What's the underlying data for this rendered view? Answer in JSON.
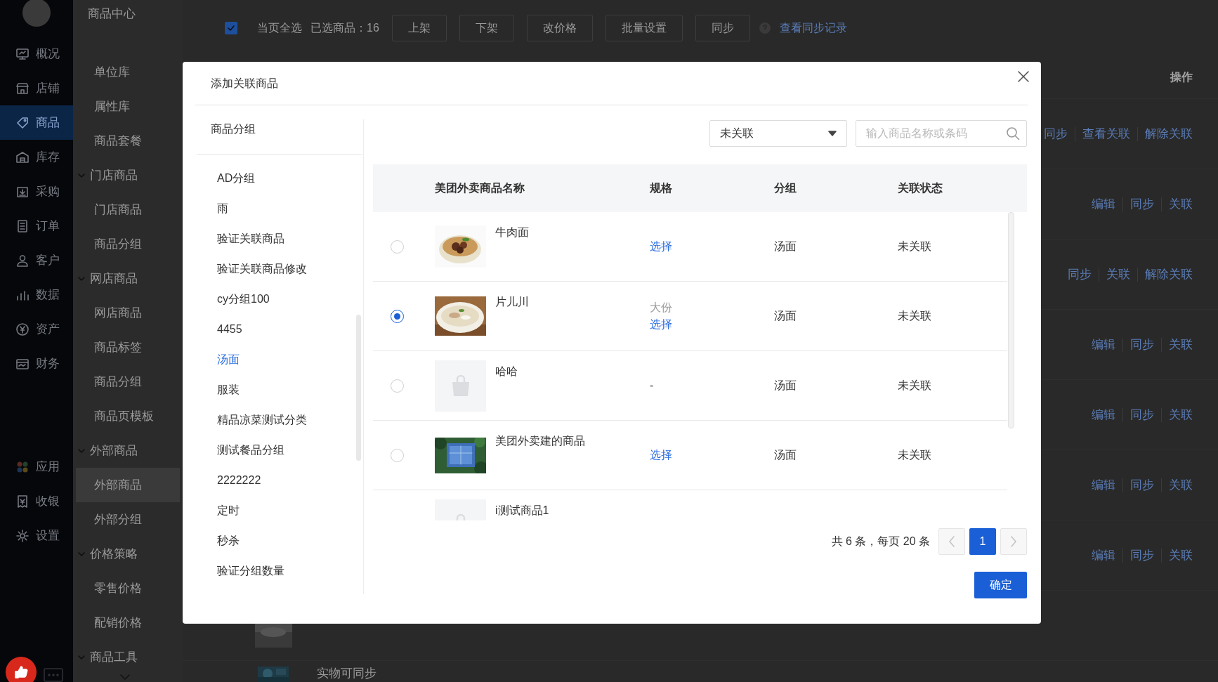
{
  "nav": {
    "items": [
      {
        "label": "概况",
        "selected": false
      },
      {
        "label": "店铺",
        "selected": false
      },
      {
        "label": "商品",
        "selected": true
      },
      {
        "label": "库存",
        "selected": false
      },
      {
        "label": "采购",
        "selected": false
      },
      {
        "label": "订单",
        "selected": false
      },
      {
        "label": "客户",
        "selected": false
      },
      {
        "label": "数据",
        "selected": false
      },
      {
        "label": "资产",
        "selected": false
      },
      {
        "label": "财务",
        "selected": false
      }
    ],
    "bottom_items": [
      {
        "label": "应用"
      },
      {
        "label": "收银"
      },
      {
        "label": "设置"
      }
    ]
  },
  "sidebar": {
    "title": "商品中心",
    "items": [
      {
        "label": "单位库",
        "selected": false
      },
      {
        "label": "属性库",
        "selected": false
      },
      {
        "label": "商品套餐",
        "selected": false
      },
      {
        "label": "门店商品",
        "expanded": true,
        "children": [
          {
            "label": "门店商品",
            "selected": false
          },
          {
            "label": "商品分组",
            "selected": false
          }
        ]
      },
      {
        "label": "网店商品",
        "expanded": true,
        "children": [
          {
            "label": "网店商品",
            "selected": false
          },
          {
            "label": "商品标签",
            "selected": false
          },
          {
            "label": "商品分组",
            "selected": false
          },
          {
            "label": "商品页模板",
            "selected": false
          }
        ]
      },
      {
        "label": "外部商品",
        "expanded": true,
        "children": [
          {
            "label": "外部商品",
            "selected": true
          },
          {
            "label": "外部分组",
            "selected": false
          }
        ]
      },
      {
        "label": "价格策略",
        "expanded": true,
        "children": [
          {
            "label": "零售价格",
            "selected": false
          },
          {
            "label": "配销价格",
            "selected": false
          }
        ]
      },
      {
        "label": "商品工具",
        "expanded": true
      }
    ]
  },
  "toolbar": {
    "select_all": {
      "label": "当页全选",
      "checked": true
    },
    "selected_count": "已选商品：16",
    "buttons": [
      "上架",
      "下架",
      "改价格",
      "批量设置",
      "同步"
    ],
    "link": "查看同步记录"
  },
  "table": {
    "action_header": "操作",
    "rows": [
      {
        "actions": [
          "同步",
          "查看关联",
          "解除关联"
        ]
      },
      {
        "actions": [
          "编辑",
          "同步",
          "关联"
        ]
      },
      {
        "actions": [
          "同步",
          "关联",
          "解除关联"
        ]
      },
      {
        "actions": [
          "编辑",
          "同步",
          "关联"
        ]
      },
      {
        "actions": [
          "编辑",
          "同步",
          "关联"
        ]
      },
      {
        "actions": [
          "编辑",
          "同步",
          "关联"
        ]
      },
      {
        "actions": [
          "编辑",
          "同步",
          "关联"
        ]
      },
      {
        "image": {
          "kind": "picture"
        }
      },
      {
        "image": {
          "kind": "picture"
        },
        "name": "实物可同步"
      }
    ]
  },
  "modal": {
    "title": "添加关联商品",
    "groups_title": "商品分组",
    "groups": [
      {
        "label": "AD分组",
        "selected": false
      },
      {
        "label": "雨",
        "selected": false
      },
      {
        "label": "验证关联商品",
        "selected": false
      },
      {
        "label": "验证关联商品修改",
        "selected": false
      },
      {
        "label": "cy分组100",
        "selected": false
      },
      {
        "label": "4455",
        "selected": false
      },
      {
        "label": "汤面",
        "selected": true
      },
      {
        "label": "服装",
        "selected": false
      },
      {
        "label": "精品凉菜测试分类",
        "selected": false
      },
      {
        "label": "测试餐品分组",
        "selected": false
      },
      {
        "label": "2222222",
        "selected": false
      },
      {
        "label": "定时",
        "selected": false
      },
      {
        "label": "秒杀",
        "selected": false
      },
      {
        "label": "验证分组数量",
        "selected": false
      }
    ],
    "filter": {
      "value": "未关联"
    },
    "search": {
      "placeholder": "输入商品名称或条码"
    },
    "columns": [
      "美团外卖商品名称",
      "规格",
      "分组",
      "关联状态"
    ],
    "rows": [
      {
        "selected": false,
        "image": {
          "kind": "picture"
        },
        "name": "牛肉面",
        "spec": [
          {
            "kind": "link",
            "text": "选择"
          }
        ],
        "group": "汤面",
        "status": "未关联"
      },
      {
        "selected": true,
        "image": {
          "kind": "picture"
        },
        "name": "片儿川",
        "spec": [
          {
            "kind": "plain",
            "text": "大份"
          },
          {
            "kind": "link",
            "text": "选择"
          }
        ],
        "group": "汤面",
        "status": "未关联"
      },
      {
        "selected": false,
        "image": {
          "kind": "placeholder"
        },
        "name": "哈哈",
        "spec": [
          {
            "kind": "text",
            "text": "-"
          }
        ],
        "group": "汤面",
        "status": "未关联"
      },
      {
        "selected": false,
        "image": {
          "kind": "picture"
        },
        "name": "美团外卖建的商品",
        "spec": [
          {
            "kind": "link",
            "text": "选择"
          }
        ],
        "group": "汤面",
        "status": "未关联"
      },
      {
        "image": {
          "kind": "placeholder"
        },
        "name": "i测试商品1"
      }
    ],
    "pagination": {
      "summary": "共 6 条，每页 20 条",
      "pages": [
        {
          "label": "1",
          "selected": true
        }
      ]
    },
    "confirm": "确定"
  }
}
